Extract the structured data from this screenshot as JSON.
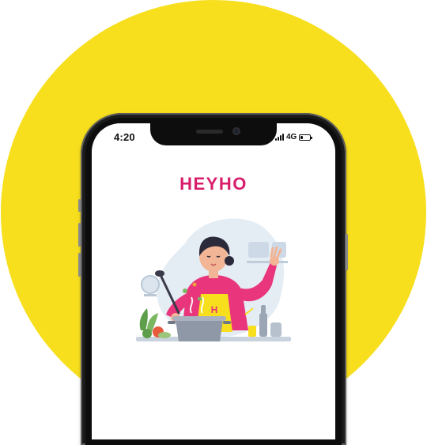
{
  "status_bar": {
    "time": "4:20",
    "network": "4G",
    "signal_bars": 4,
    "battery_level": 0.3
  },
  "app": {
    "title": "HEYHO"
  },
  "illustration": {
    "subject": "chef-cooking-illustration",
    "apron_letter": "H"
  },
  "colors": {
    "background_circle": "#F7DF1E",
    "brand": "#D81E6B",
    "phone_frame": "#1b1b1b",
    "screen": "#ffffff"
  }
}
